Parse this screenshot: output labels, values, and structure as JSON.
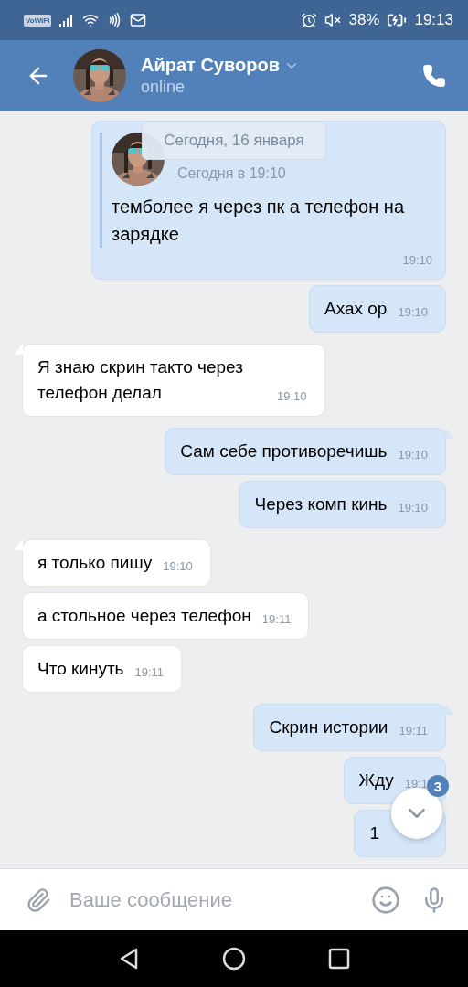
{
  "status_bar": {
    "carrier": "VoWiFi",
    "battery": "38%",
    "time": "19:13"
  },
  "header": {
    "name": "Айрат Суворов",
    "status": "online"
  },
  "date_pill": "Сегодня, 16 января",
  "messages": [
    {
      "kind": "outgoing",
      "tail": false,
      "quote": {
        "time": "Сегодня в 19:10"
      },
      "text": "темболее я через пк а телефон на зарядке",
      "time": "19:10"
    },
    {
      "kind": "outgoing",
      "tail": false,
      "text": "Ахах ор",
      "time": "19:10"
    },
    {
      "kind": "incoming",
      "tail": true,
      "text": "Я знаю скрин такто через телефон делал",
      "time": "19:10"
    },
    {
      "kind": "outgoing",
      "tail": true,
      "text": "Сам себе противоречишь",
      "time": "19:10"
    },
    {
      "kind": "outgoing",
      "tail": false,
      "text": "Через комп кинь",
      "time": "19:10"
    },
    {
      "kind": "incoming",
      "tail": true,
      "text": "я только пишу",
      "time": "19:10"
    },
    {
      "kind": "incoming",
      "tail": false,
      "text": "а стольное через телефон",
      "time": "19:11"
    },
    {
      "kind": "incoming",
      "tail": false,
      "text": "Что кинуть",
      "time": "19:11"
    },
    {
      "kind": "outgoing",
      "tail": true,
      "text": "Скрин истории",
      "time": "19:11"
    },
    {
      "kind": "outgoing",
      "tail": false,
      "text": "Жду",
      "time": "19:1"
    },
    {
      "kind": "outgoing",
      "tail": false,
      "text": "1"
    }
  ],
  "unread_badge": "3",
  "composer": {
    "placeholder": "Ваше сообщение"
  }
}
